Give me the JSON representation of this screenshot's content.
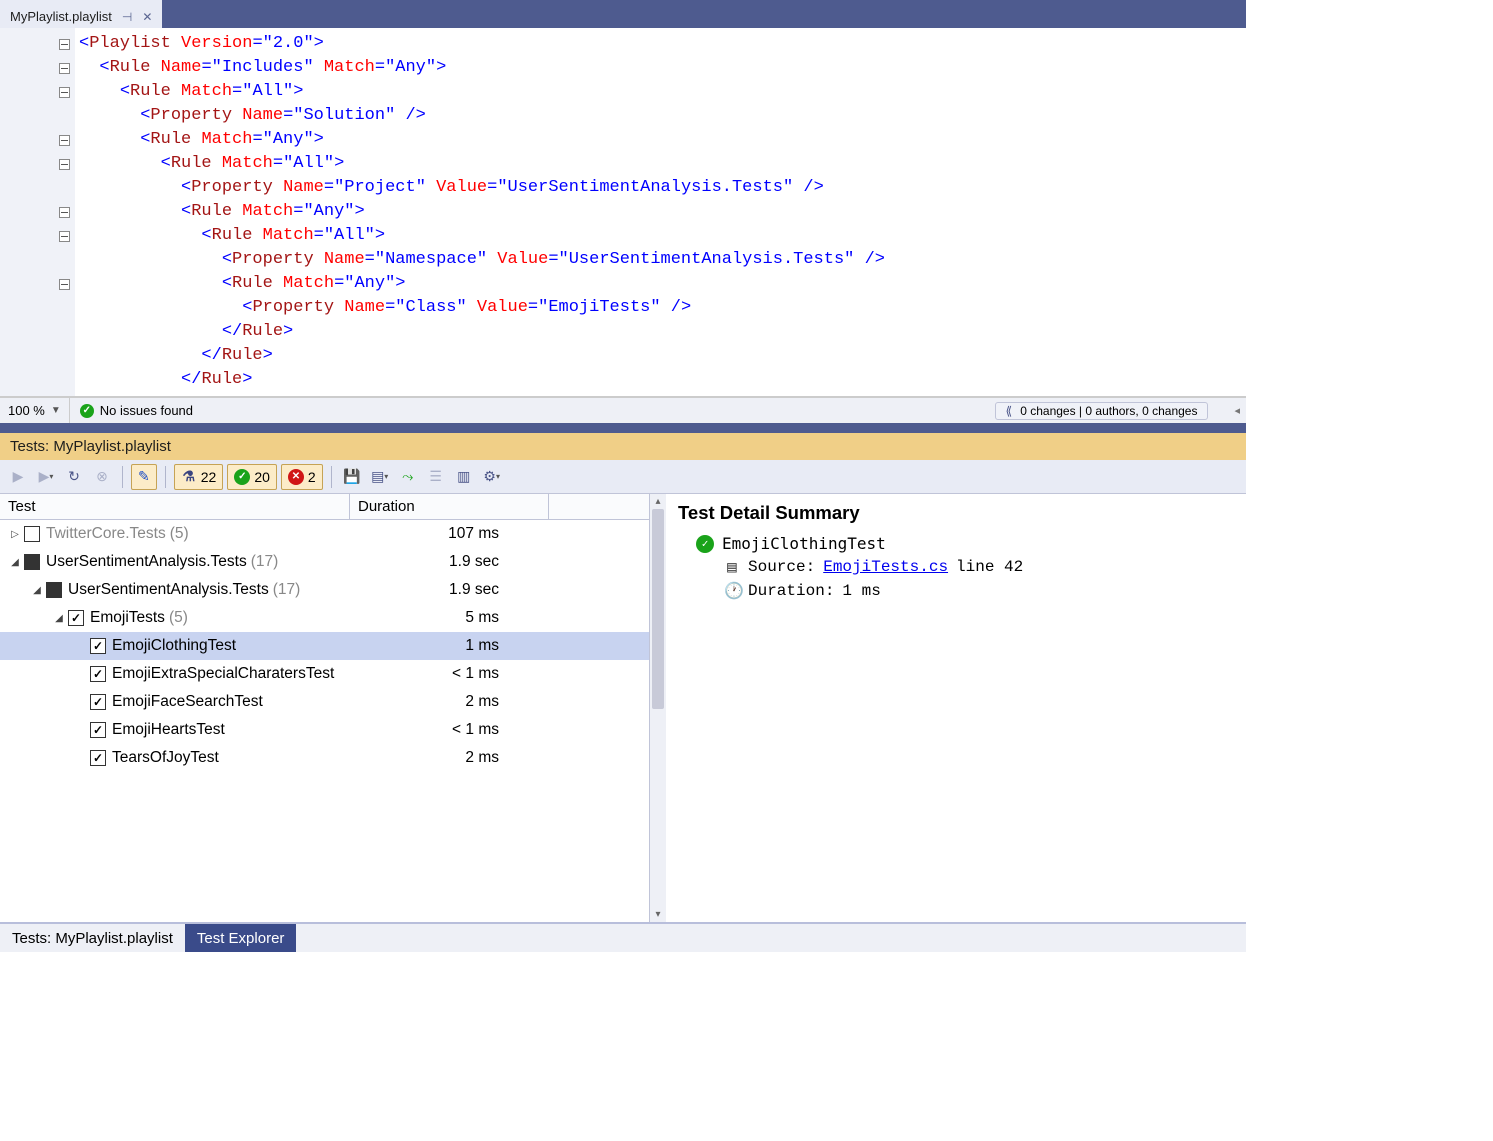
{
  "editor": {
    "tab_name": "MyPlaylist.playlist",
    "zoom": "100 %",
    "issues_text": "No issues found",
    "changes_text": "0 changes | 0 authors, 0 changes",
    "code_lines": [
      {
        "indent": 0,
        "tokens": [
          [
            "<",
            "t-blue"
          ],
          [
            "Playlist ",
            "t-brown"
          ],
          [
            "Version",
            "t-red"
          ],
          [
            "=",
            "t-blue"
          ],
          [
            "\"2.0\"",
            "t-blue"
          ],
          [
            ">",
            "t-blue"
          ]
        ]
      },
      {
        "indent": 1,
        "tokens": [
          [
            "<",
            "t-blue"
          ],
          [
            "Rule ",
            "t-brown"
          ],
          [
            "Name",
            "t-red"
          ],
          [
            "=",
            "t-blue"
          ],
          [
            "\"Includes\" ",
            "t-blue"
          ],
          [
            "Match",
            "t-red"
          ],
          [
            "=",
            "t-blue"
          ],
          [
            "\"Any\"",
            "t-blue"
          ],
          [
            ">",
            "t-blue"
          ]
        ]
      },
      {
        "indent": 2,
        "tokens": [
          [
            "<",
            "t-blue"
          ],
          [
            "Rule ",
            "t-brown"
          ],
          [
            "Match",
            "t-red"
          ],
          [
            "=",
            "t-blue"
          ],
          [
            "\"All\"",
            "t-blue"
          ],
          [
            ">",
            "t-blue"
          ]
        ]
      },
      {
        "indent": 3,
        "tokens": [
          [
            "<",
            "t-blue"
          ],
          [
            "Property ",
            "t-brown"
          ],
          [
            "Name",
            "t-red"
          ],
          [
            "=",
            "t-blue"
          ],
          [
            "\"Solution\" ",
            "t-blue"
          ],
          [
            "/>",
            "t-blue"
          ]
        ]
      },
      {
        "indent": 3,
        "tokens": [
          [
            "<",
            "t-blue"
          ],
          [
            "Rule ",
            "t-brown"
          ],
          [
            "Match",
            "t-red"
          ],
          [
            "=",
            "t-blue"
          ],
          [
            "\"Any\"",
            "t-blue"
          ],
          [
            ">",
            "t-blue"
          ]
        ]
      },
      {
        "indent": 4,
        "tokens": [
          [
            "<",
            "t-blue"
          ],
          [
            "Rule ",
            "t-brown"
          ],
          [
            "Match",
            "t-red"
          ],
          [
            "=",
            "t-blue"
          ],
          [
            "\"All\"",
            "t-blue"
          ],
          [
            ">",
            "t-blue"
          ]
        ]
      },
      {
        "indent": 5,
        "tokens": [
          [
            "<",
            "t-blue"
          ],
          [
            "Property ",
            "t-brown"
          ],
          [
            "Name",
            "t-red"
          ],
          [
            "=",
            "t-blue"
          ],
          [
            "\"Project\" ",
            "t-blue"
          ],
          [
            "Value",
            "t-red"
          ],
          [
            "=",
            "t-blue"
          ],
          [
            "\"UserSentimentAnalysis.Tests\" ",
            "t-blue"
          ],
          [
            "/>",
            "t-blue"
          ]
        ]
      },
      {
        "indent": 5,
        "tokens": [
          [
            "<",
            "t-blue"
          ],
          [
            "Rule ",
            "t-brown"
          ],
          [
            "Match",
            "t-red"
          ],
          [
            "=",
            "t-blue"
          ],
          [
            "\"Any\"",
            "t-blue"
          ],
          [
            ">",
            "t-blue"
          ]
        ]
      },
      {
        "indent": 6,
        "tokens": [
          [
            "<",
            "t-blue"
          ],
          [
            "Rule ",
            "t-brown"
          ],
          [
            "Match",
            "t-red"
          ],
          [
            "=",
            "t-blue"
          ],
          [
            "\"All\"",
            "t-blue"
          ],
          [
            ">",
            "t-blue"
          ]
        ]
      },
      {
        "indent": 7,
        "tokens": [
          [
            "<",
            "t-blue"
          ],
          [
            "Property ",
            "t-brown"
          ],
          [
            "Name",
            "t-red"
          ],
          [
            "=",
            "t-blue"
          ],
          [
            "\"Namespace\" ",
            "t-blue"
          ],
          [
            "Value",
            "t-red"
          ],
          [
            "=",
            "t-blue"
          ],
          [
            "\"UserSentimentAnalysis.Tests\" ",
            "t-blue"
          ],
          [
            "/>",
            "t-blue"
          ]
        ]
      },
      {
        "indent": 7,
        "tokens": [
          [
            "<",
            "t-blue"
          ],
          [
            "Rule ",
            "t-brown"
          ],
          [
            "Match",
            "t-red"
          ],
          [
            "=",
            "t-blue"
          ],
          [
            "\"Any\"",
            "t-blue"
          ],
          [
            ">",
            "t-blue"
          ]
        ]
      },
      {
        "indent": 8,
        "tokens": [
          [
            "<",
            "t-blue"
          ],
          [
            "Property ",
            "t-brown"
          ],
          [
            "Name",
            "t-red"
          ],
          [
            "=",
            "t-blue"
          ],
          [
            "\"Class\" ",
            "t-blue"
          ],
          [
            "Value",
            "t-red"
          ],
          [
            "=",
            "t-blue"
          ],
          [
            "\"EmojiTests\" ",
            "t-blue"
          ],
          [
            "/>",
            "t-blue"
          ]
        ]
      },
      {
        "indent": 7,
        "tokens": [
          [
            "</",
            "t-blue"
          ],
          [
            "Rule",
            "t-brown"
          ],
          [
            ">",
            "t-blue"
          ]
        ]
      },
      {
        "indent": 6,
        "tokens": [
          [
            "</",
            "t-blue"
          ],
          [
            "Rule",
            "t-brown"
          ],
          [
            ">",
            "t-blue"
          ]
        ]
      },
      {
        "indent": 5,
        "tokens": [
          [
            "</",
            "t-blue"
          ],
          [
            "Rule",
            "t-brown"
          ],
          [
            ">",
            "t-blue"
          ]
        ]
      }
    ],
    "fold_rows": [
      0,
      1,
      2,
      4,
      5,
      7,
      8,
      10
    ]
  },
  "tests": {
    "title": "Tests: MyPlaylist.playlist",
    "counts": {
      "total": "22",
      "passed": "20",
      "failed": "2"
    },
    "columns": {
      "test": "Test",
      "duration": "Duration"
    },
    "tree": [
      {
        "indent": 0,
        "tri": "▷",
        "box": "empty",
        "label": "TwitterCore.Tests",
        "count": "(5)",
        "dur": "107 ms",
        "dim": true
      },
      {
        "indent": 0,
        "tri": "◢",
        "box": "filled",
        "label": "UserSentimentAnalysis.Tests",
        "count": "(17)",
        "dur": "1.9 sec"
      },
      {
        "indent": 1,
        "tri": "◢",
        "box": "filled",
        "label": "UserSentimentAnalysis.Tests",
        "count": "(17)",
        "dur": "1.9 sec"
      },
      {
        "indent": 2,
        "tri": "◢",
        "box": "checked",
        "label": "EmojiTests",
        "count": "(5)",
        "dur": "5 ms"
      },
      {
        "indent": 3,
        "tri": "",
        "box": "checked",
        "label": "EmojiClothingTest",
        "count": "",
        "dur": "1 ms",
        "selected": true
      },
      {
        "indent": 3,
        "tri": "",
        "box": "checked",
        "label": "EmojiExtraSpecialCharatersTest",
        "count": "",
        "dur": "< 1 ms"
      },
      {
        "indent": 3,
        "tri": "",
        "box": "checked",
        "label": "EmojiFaceSearchTest",
        "count": "",
        "dur": "2 ms"
      },
      {
        "indent": 3,
        "tri": "",
        "box": "checked",
        "label": "EmojiHeartsTest",
        "count": "",
        "dur": "< 1 ms"
      },
      {
        "indent": 3,
        "tri": "",
        "box": "checked",
        "label": "TearsOfJoyTest",
        "count": "",
        "dur": "2 ms"
      }
    ]
  },
  "detail": {
    "title": "Test Detail Summary",
    "test_name": "EmojiClothingTest",
    "source_label": "Source:",
    "source_file": "EmojiTests.cs",
    "source_line": "line 42",
    "duration_label": "Duration:",
    "duration_value": "1 ms"
  },
  "bottom_tabs": {
    "tab1": "Tests: MyPlaylist.playlist",
    "tab2": "Test Explorer"
  }
}
